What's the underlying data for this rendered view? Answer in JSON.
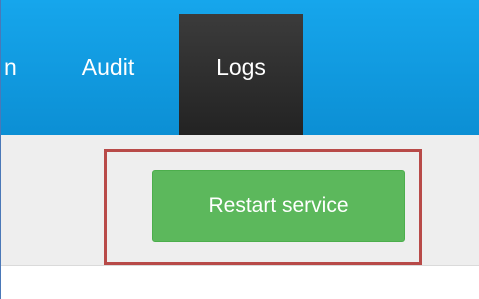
{
  "nav": {
    "partial_item": "n",
    "items": [
      {
        "label": "Audit"
      },
      {
        "label": "Logs",
        "active": true
      }
    ]
  },
  "toolbar": {
    "restart_label": "Restart service"
  },
  "colors": {
    "navbar": "#0c8fd4",
    "active_tab": "#2b2b2b",
    "button": "#5cb85c",
    "highlight": "#b84a48"
  }
}
